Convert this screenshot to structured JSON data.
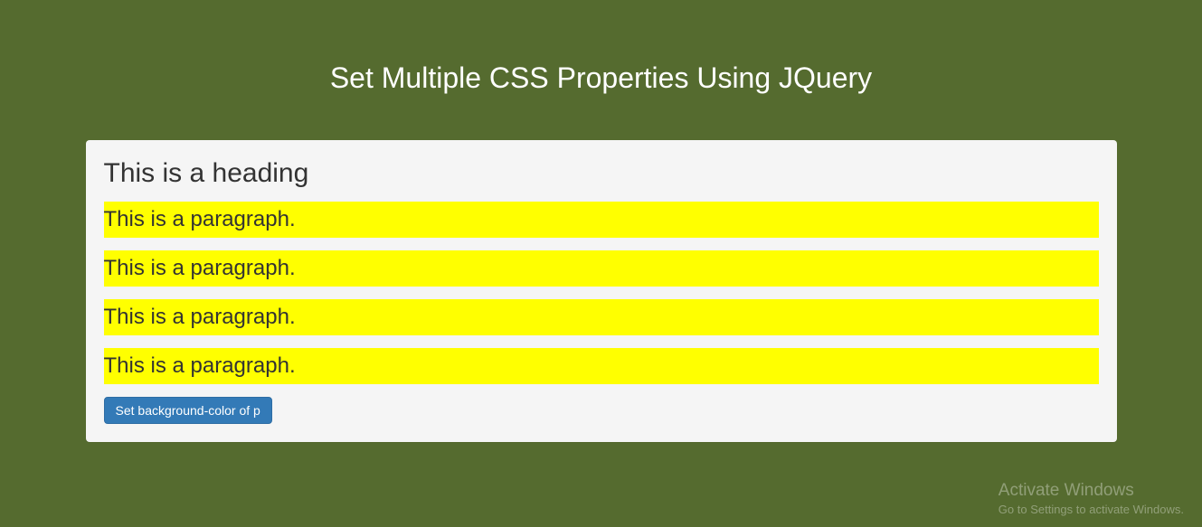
{
  "page": {
    "title": "Set Multiple CSS Properties Using JQuery"
  },
  "content": {
    "heading": "This is a heading",
    "paragraphs": [
      "This is a paragraph.",
      "This is a paragraph.",
      "This is a paragraph.",
      "This is a paragraph."
    ],
    "button_label": "Set background-color of p"
  },
  "watermark": {
    "title": "Activate Windows",
    "subtitle": "Go to Settings to activate Windows."
  },
  "colors": {
    "page_bg": "#556b2f",
    "panel_bg": "#f5f5f5",
    "highlight": "#ffff00",
    "button_bg": "#337ab7"
  }
}
